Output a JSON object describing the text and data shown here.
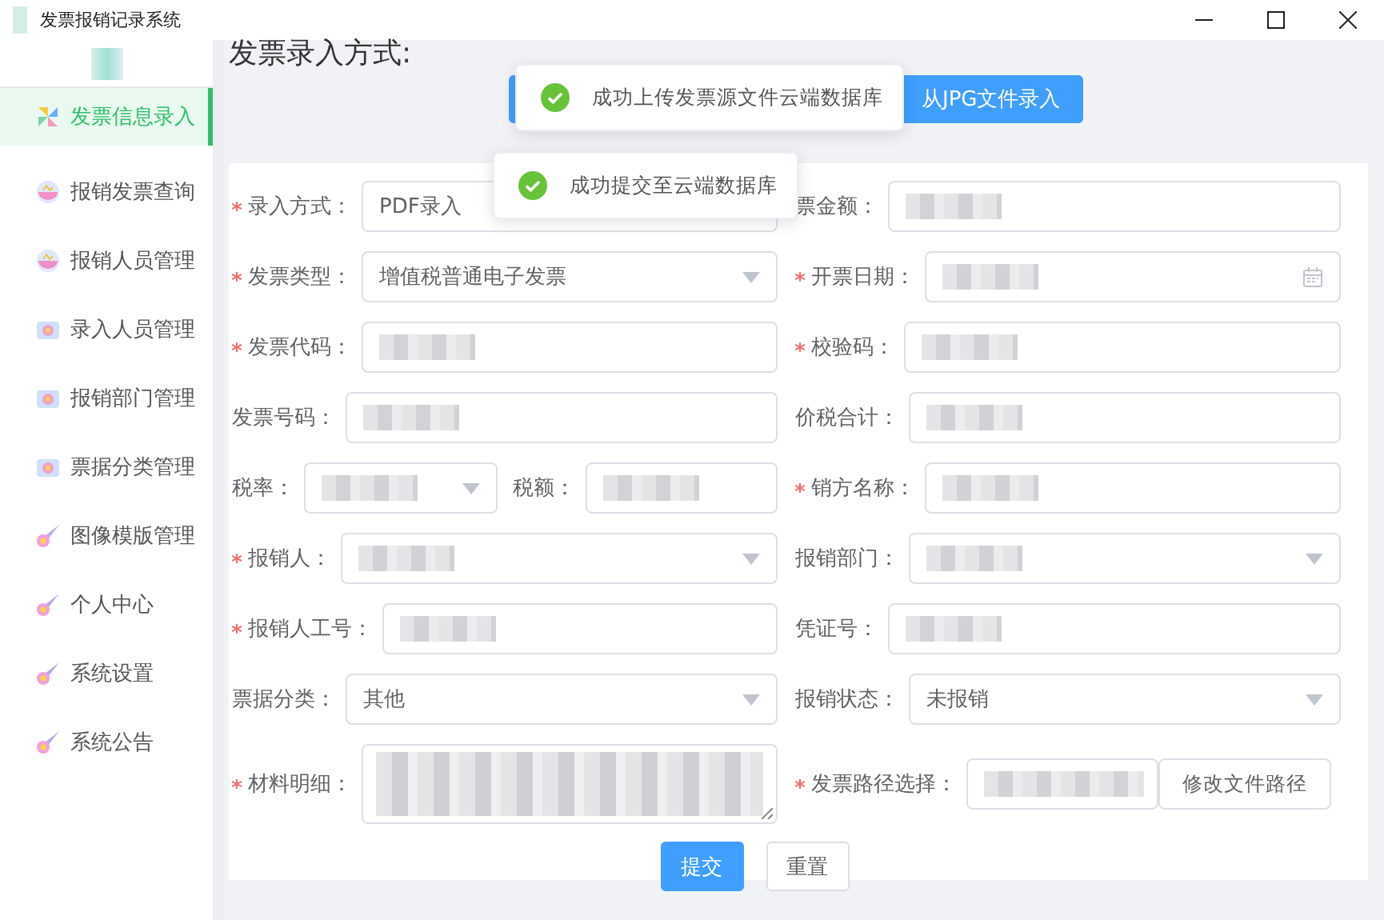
{
  "window": {
    "title": "发票报销记录系统"
  },
  "sidebar": {
    "items": [
      {
        "label": "发票信息录入",
        "kind": "pinwheel",
        "selected": true
      },
      {
        "label": "报销发票查询",
        "kind": "bowl",
        "selected": false
      },
      {
        "label": "报销人员管理",
        "kind": "bowl",
        "selected": false
      },
      {
        "label": "录入人员管理",
        "kind": "camera",
        "selected": false
      },
      {
        "label": "报销部门管理",
        "kind": "camera",
        "selected": false
      },
      {
        "label": "票据分类管理",
        "kind": "camera",
        "selected": false
      },
      {
        "label": "图像模版管理",
        "kind": "comet",
        "selected": false
      },
      {
        "label": "个人中心",
        "kind": "comet",
        "selected": false
      },
      {
        "label": "系统设置",
        "kind": "comet",
        "selected": false
      },
      {
        "label": "系统公告",
        "kind": "comet",
        "selected": false
      }
    ]
  },
  "heading": "发票录入方式:",
  "mode_buttons": [
    {
      "covered": true
    },
    {
      "label": "从JPG文件录入",
      "covered": false
    }
  ],
  "toasts": [
    {
      "text": "成功上传发票源文件云端数据库"
    },
    {
      "text": "成功提交至云端数据库"
    }
  ],
  "form": {
    "rows": [
      {
        "left": [
          {
            "label": "录入方式：",
            "required": true,
            "kind": "input",
            "value": "PDF录入"
          }
        ],
        "right": [
          {
            "label": "票金额：",
            "required": false,
            "kind": "input",
            "redacted": true
          }
        ]
      },
      {
        "left": [
          {
            "label": "发票类型：",
            "required": true,
            "kind": "select",
            "value": "增值税普通电子发票"
          }
        ],
        "right": [
          {
            "label": "开票日期：",
            "required": true,
            "kind": "date",
            "redacted": true
          }
        ]
      },
      {
        "left": [
          {
            "label": "发票代码：",
            "required": true,
            "kind": "input",
            "redacted": true
          }
        ],
        "right": [
          {
            "label": "校验码：",
            "required": true,
            "kind": "input",
            "redacted": true
          }
        ]
      },
      {
        "left": [
          {
            "label": "发票号码：",
            "required": false,
            "kind": "input",
            "redacted": true
          }
        ],
        "right": [
          {
            "label": "价税合计：",
            "required": false,
            "kind": "input",
            "redacted": true
          }
        ]
      },
      {
        "left": [
          {
            "label": "税率：",
            "required": false,
            "kind": "select",
            "redacted": true
          },
          {
            "label": "税额：",
            "required": false,
            "kind": "input",
            "redacted": true
          }
        ],
        "right": [
          {
            "label": "销方名称：",
            "required": true,
            "kind": "input",
            "redacted": true
          }
        ]
      },
      {
        "left": [
          {
            "label": "报销人：",
            "required": true,
            "kind": "select",
            "redacted": true
          }
        ],
        "right": [
          {
            "label": "报销部门：",
            "required": false,
            "kind": "select",
            "redacted": true
          }
        ]
      },
      {
        "left": [
          {
            "label": "报销人工号：",
            "required": true,
            "kind": "input",
            "redacted": true
          }
        ],
        "right": [
          {
            "label": "凭证号：",
            "required": false,
            "kind": "input",
            "redacted": true
          }
        ]
      },
      {
        "left": [
          {
            "label": "票据分类：",
            "required": false,
            "kind": "select",
            "value": "其他"
          }
        ],
        "right": [
          {
            "label": "报销状态：",
            "required": false,
            "kind": "select",
            "value": "未报销"
          }
        ]
      },
      {
        "left": [
          {
            "label": "材料明细：",
            "required": true,
            "kind": "textarea",
            "redacted": true
          }
        ],
        "right": [
          {
            "label": "发票路径选择：",
            "required": true,
            "kind": "path",
            "redacted": true,
            "button": "修改文件路径"
          }
        ]
      }
    ]
  },
  "actions": [
    {
      "label": "提交",
      "kind": "primary"
    },
    {
      "label": "重置",
      "kind": "default"
    }
  ]
}
